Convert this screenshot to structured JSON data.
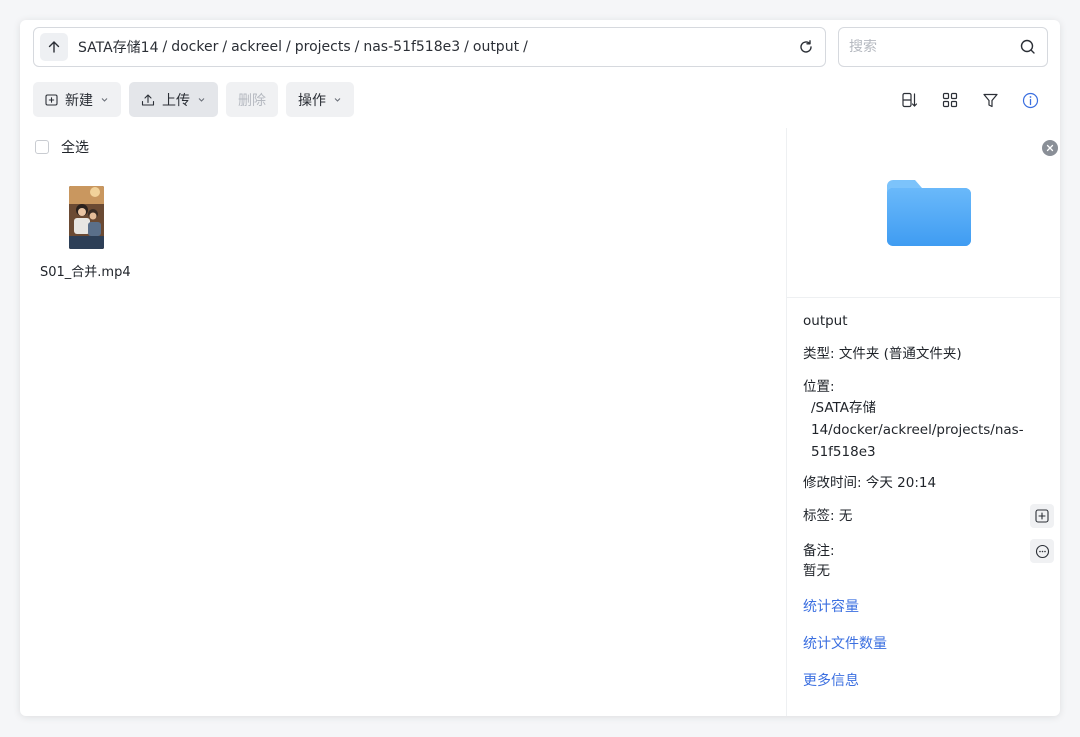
{
  "address": {
    "segments": [
      "SATA存储14",
      "docker",
      "ackreel",
      "projects",
      "nas-51f518e3",
      "output"
    ],
    "separator": "/"
  },
  "search": {
    "placeholder": "搜索"
  },
  "toolbar": {
    "new_label": "新建",
    "upload_label": "上传",
    "delete_label": "删除",
    "actions_label": "操作"
  },
  "select_all": {
    "label": "全选"
  },
  "files": [
    {
      "name": "S01_合并.mp4"
    }
  ],
  "details": {
    "name": "output",
    "type_label": "类型:",
    "type_value": "文件夹 (普通文件夹)",
    "location_label": "位置:",
    "location_value_lines": [
      "/SATA存储",
      "14/docker/ackreel/projects/nas-",
      "51f518e3"
    ],
    "mtime_label": "修改时间:",
    "mtime_value": "今天 20:14",
    "tags_label": "标签:",
    "tags_value": "无",
    "note_label": "备注:",
    "note_value": "暂无",
    "links": [
      "统计容量",
      "统计文件数量",
      "更多信息"
    ]
  },
  "colors": {
    "accent": "#3b6fe0",
    "folder": "#4aa8f7"
  }
}
